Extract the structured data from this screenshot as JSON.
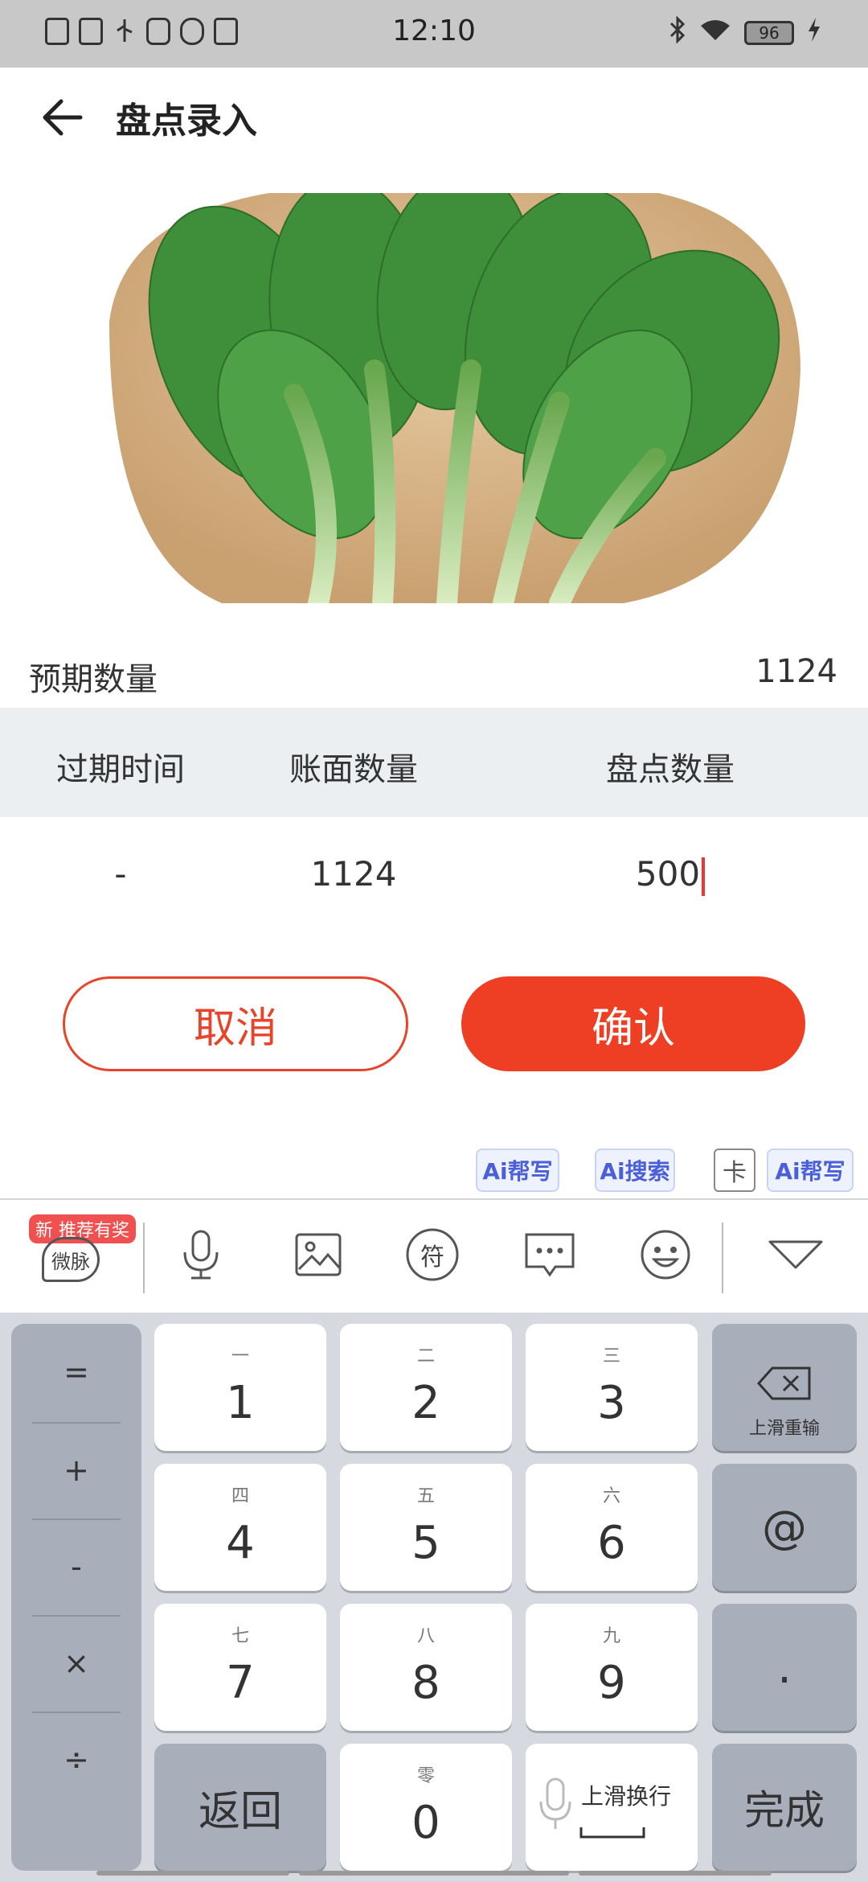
{
  "status_bar": {
    "time": "12:10",
    "battery": "96",
    "left_icons": [
      "sim-off-icon",
      "usb-icon",
      "usb-debug-icon",
      "media-icon",
      "app-icon",
      "book-icon"
    ],
    "right_icons": [
      "bluetooth-icon",
      "wifi-icon",
      "battery-icon",
      "charging-icon"
    ]
  },
  "header": {
    "title": "盘点录入",
    "back_icon": "arrow-left-icon"
  },
  "product": {
    "image": "leafy-green-vegetable"
  },
  "expected": {
    "label": "预期数量",
    "value": "1124"
  },
  "table": {
    "headers": [
      "过期时间",
      "账面数量",
      "盘点数量"
    ],
    "row": {
      "expiry": "-",
      "book_qty": "1124",
      "count_qty": "500"
    }
  },
  "buttons": {
    "cancel": "取消",
    "confirm": "确认"
  },
  "colors": {
    "accent": "#ee3f24",
    "table_header_bg": "#eceff2"
  },
  "ai_strip": {
    "help_write": "Ai帮写",
    "search": "Ai搜索",
    "card": "卡",
    "help_write_2": "Ai帮写"
  },
  "keyboard_toolbar": {
    "promo_badge": "新 推荐有奖",
    "weimai": "微脉",
    "symbols": "符"
  },
  "keyboard": {
    "symbols": [
      "=",
      "+",
      "-",
      "×",
      "÷"
    ],
    "keys": [
      {
        "sub": "一",
        "main": "1"
      },
      {
        "sub": "二",
        "main": "2"
      },
      {
        "sub": "三",
        "main": "3"
      },
      {
        "sub": "四",
        "main": "4"
      },
      {
        "sub": "五",
        "main": "5"
      },
      {
        "sub": "六",
        "main": "6"
      },
      {
        "sub": "七",
        "main": "7"
      },
      {
        "sub": "八",
        "main": "8"
      },
      {
        "sub": "九",
        "main": "9"
      },
      {
        "sub": "零",
        "main": "0"
      }
    ],
    "backspace_sub": "上滑重输",
    "at": "@",
    "dot": ".",
    "back": "返回",
    "space_label": "上滑换行",
    "done": "完成"
  }
}
